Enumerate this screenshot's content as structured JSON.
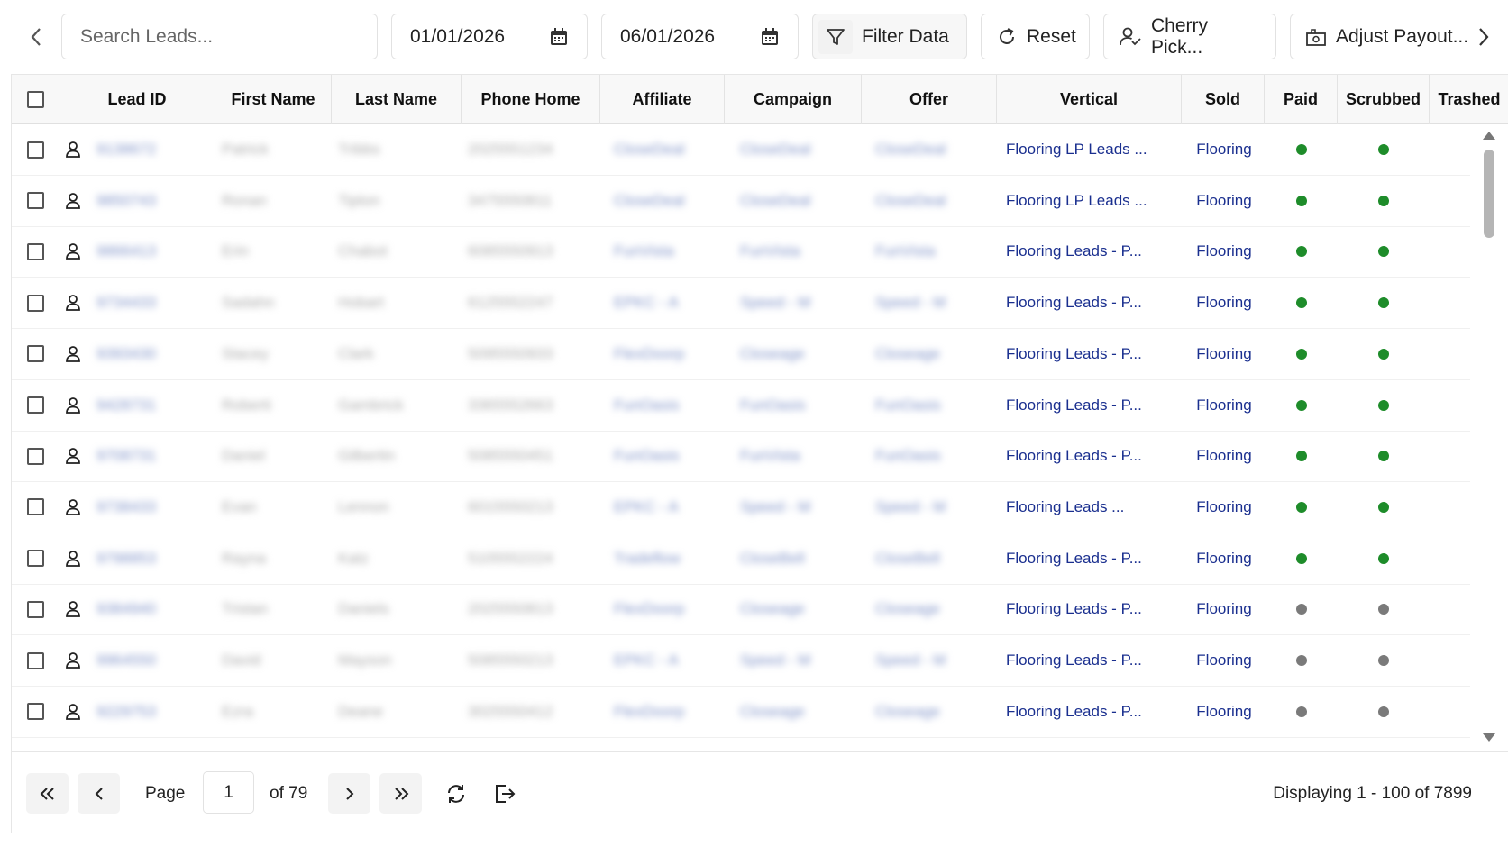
{
  "toolbar": {
    "search_placeholder": "Search Leads...",
    "date_from": "01/01/2026",
    "date_to": "06/01/2026",
    "filter_label": "Filter Data",
    "reset_label": "Reset",
    "cherry_pick_label": "Cherry Pick...",
    "adjust_payout_label": "Adjust Payout..."
  },
  "table": {
    "columns": [
      "Lead ID",
      "First Name",
      "Last Name",
      "Phone Home",
      "Affiliate",
      "Campaign",
      "Offer",
      "Vertical",
      "Sold",
      "Paid",
      "Scrubbed",
      "Trashed"
    ],
    "rows": [
      {
        "lead_id": "9138672",
        "first": "Patrick",
        "last": "Tribbs",
        "phone": "2025551234",
        "affiliate": "CloseDeal",
        "campaign": "CloseDeal",
        "offer": "CloseDeal",
        "vertical": "Flooring LP Leads  ...",
        "sold": "Flooring",
        "paid": "green",
        "scrubbed": "green"
      },
      {
        "lead_id": "9850743",
        "first": "Ronan",
        "last": "Tipton",
        "phone": "3475550811",
        "affiliate": "CloseDeal",
        "campaign": "CloseDeal",
        "offer": "CloseDeal",
        "vertical": "Flooring LP Leads ...",
        "sold": "Flooring",
        "paid": "green",
        "scrubbed": "green"
      },
      {
        "lead_id": "9866413",
        "first": "Erin",
        "last": "Chabot",
        "phone": "6085550913",
        "affiliate": "FunVista",
        "campaign": "FunVista",
        "offer": "FunVista",
        "vertical": "Flooring Leads - P...",
        "sold": "Flooring",
        "paid": "green",
        "scrubbed": "green"
      },
      {
        "lead_id": "9734433",
        "first": "Sadahn",
        "last": "Hobart",
        "phone": "6125552247",
        "affiliate": "EPKC - A",
        "campaign": "Speed - M",
        "offer": "Speed - M",
        "vertical": "Flooring Leads - P...",
        "sold": "Flooring",
        "paid": "green",
        "scrubbed": "green"
      },
      {
        "lead_id": "9393430",
        "first": "Stacey",
        "last": "Clark",
        "phone": "5095550933",
        "affiliate": "FlexDoorp",
        "campaign": "Closeage",
        "offer": "Closeage",
        "vertical": "Flooring Leads - P...",
        "sold": "Flooring",
        "paid": "green",
        "scrubbed": "green"
      },
      {
        "lead_id": "9428731",
        "first": "Roberti",
        "last": "Gambrick",
        "phone": "3365552663",
        "affiliate": "FunOasis",
        "campaign": "FunOasis",
        "offer": "FunOasis",
        "vertical": "Flooring Leads - P...",
        "sold": "Flooring",
        "paid": "green",
        "scrubbed": "green"
      },
      {
        "lead_id": "9708731",
        "first": "Daniel",
        "last": "Gilbertin",
        "phone": "5085550451",
        "affiliate": "FunOasis",
        "campaign": "FunVista",
        "offer": "FunOasis",
        "vertical": "Flooring Leads - P...",
        "sold": "Flooring",
        "paid": "green",
        "scrubbed": "green"
      },
      {
        "lead_id": "9738433",
        "first": "Evan",
        "last": "Lennon",
        "phone": "6015550213",
        "affiliate": "EPKC - A",
        "campaign": "Speed - M",
        "offer": "Speed - M",
        "vertical": "Flooring Leads  ...",
        "sold": "Flooring",
        "paid": "green",
        "scrubbed": "green"
      },
      {
        "lead_id": "9798853",
        "first": "Rayna",
        "last": "Katz",
        "phone": "5105552224",
        "affiliate": "Tradeflow",
        "campaign": "CloseBell",
        "offer": "CloseBell",
        "vertical": "Flooring Leads - P...",
        "sold": "Flooring",
        "paid": "green",
        "scrubbed": "green"
      },
      {
        "lead_id": "9384940",
        "first": "Tristan",
        "last": "Daniels",
        "phone": "2025550813",
        "affiliate": "FlexDoorp",
        "campaign": "Closeage",
        "offer": "Closeage",
        "vertical": "Flooring Leads - P...",
        "sold": "Flooring",
        "paid": "grey",
        "scrubbed": "grey"
      },
      {
        "lead_id": "9964550",
        "first": "David",
        "last": "Mayson",
        "phone": "5085550213",
        "affiliate": "EPKC - A",
        "campaign": "Speed - M",
        "offer": "Speed - M",
        "vertical": "Flooring Leads - P...",
        "sold": "Flooring",
        "paid": "grey",
        "scrubbed": "grey"
      },
      {
        "lead_id": "9229753",
        "first": "Ezra",
        "last": "Deane",
        "phone": "3025550412",
        "affiliate": "FlexDoorp",
        "campaign": "Closeage",
        "offer": "Closeage",
        "vertical": "Flooring Leads - P...",
        "sold": "Flooring",
        "paid": "grey",
        "scrubbed": "grey"
      }
    ]
  },
  "colors": {
    "dot_green": "#1e8c2a",
    "dot_grey": "#7a7a7a",
    "link": "#1a2f8f"
  },
  "pagination": {
    "page_label": "Page",
    "current_page": "1",
    "of_label": "of 79",
    "displaying": "Displaying 1 - 100 of 7899"
  },
  "icons": [
    "chevron-left-icon",
    "calendar-icon",
    "filter-icon",
    "reset-icon",
    "user-check-icon",
    "adjust-payout-icon",
    "chevron-right-icon",
    "user-icon",
    "first-page-icon",
    "prev-page-icon",
    "next-page-icon",
    "last-page-icon",
    "refresh-icon",
    "export-icon"
  ]
}
